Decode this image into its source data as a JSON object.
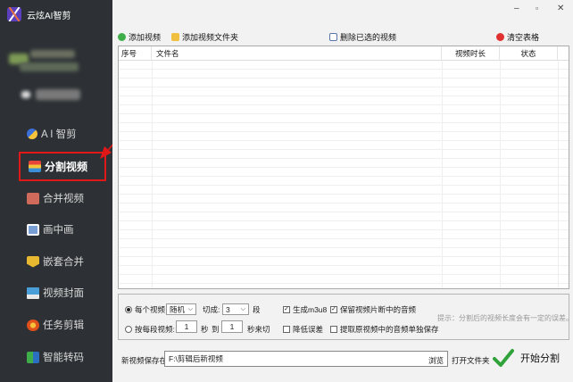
{
  "app": {
    "title": "云炫AI智剪"
  },
  "sidebar": {
    "items": [
      {
        "label": "A I 智剪",
        "icon": "ai-sparkle-icon",
        "color": "#3a6fd8"
      },
      {
        "label": "分割视频",
        "icon": "split-video-icon",
        "color": "#e8443a",
        "active": true
      },
      {
        "label": "合并视频",
        "icon": "merge-video-icon",
        "color": "#d06a5a"
      },
      {
        "label": "画中画",
        "icon": "picture-in-picture-icon",
        "color": "#7a9fd4"
      },
      {
        "label": "嵌套合并",
        "icon": "nested-merge-icon",
        "color": "#e8b830"
      },
      {
        "label": "视频封面",
        "icon": "video-cover-icon",
        "color": "#4a9fd8"
      },
      {
        "label": "任务剪辑",
        "icon": "task-edit-icon",
        "color": "#e0501a"
      },
      {
        "label": "智能转码",
        "icon": "smart-transcode-icon",
        "color": "#3fae4a"
      }
    ]
  },
  "window": {
    "minimize": "‒",
    "maximize": "▫",
    "close": "✕"
  },
  "toolbar": {
    "add_video": "添加视频",
    "add_folder": "添加视频文件夹",
    "remove_selected": "删除已选的视频",
    "clear_table": "清空表格"
  },
  "table": {
    "columns": [
      "序号",
      "文件名",
      "视频时长",
      "状态"
    ],
    "rows": []
  },
  "options": {
    "each_video_label": "每个视频",
    "mode_select": "随机",
    "cut_into_label": "切成:",
    "segments_value": "3",
    "segments_unit": "段",
    "by_segment_label": "按每段视频:",
    "start_sec": "1",
    "sec_unit": "秒",
    "to_label": "到",
    "end_sec": "1",
    "sec_cut_label": "秒来切",
    "gen_m3u8": "生成m3u8",
    "reduce_error": "降低误差",
    "keep_audio": "保留视频片断中的音频",
    "extract_audio": "提取原视频中的音频单独保存",
    "hint": "提示：分割后的视频长度会有一定的误差。"
  },
  "output": {
    "save_label": "新视频保存在:",
    "path_value": "F:\\剪辑后新视频",
    "browse": "浏览",
    "open_folder": "打开文件夹",
    "start": "开始分割"
  }
}
